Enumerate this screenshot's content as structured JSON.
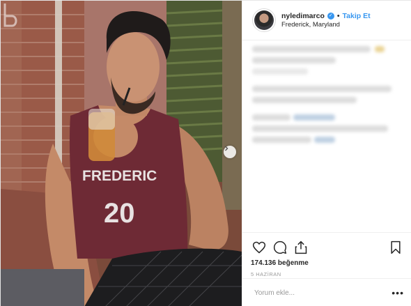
{
  "header": {
    "username": "nyledimarco",
    "follow_label": "Takip Et",
    "location": "Frederick, Maryland",
    "separator": "•"
  },
  "photo": {
    "jersey_text": "FREDERIC",
    "jersey_number": "20"
  },
  "actions": {
    "likes": "174.136 beğenme",
    "date": "5 HAZİRAN"
  },
  "comment": {
    "placeholder": "Yorum ekle...",
    "more_label": "•••"
  },
  "colors": {
    "accent": "#3897f0",
    "text": "#262626",
    "muted": "#999999",
    "border": "#efefef"
  },
  "icons": [
    "verified-badge-icon",
    "heart-icon",
    "comment-icon",
    "share-icon",
    "bookmark-icon",
    "chevron-right-icon",
    "more-options-icon"
  ]
}
